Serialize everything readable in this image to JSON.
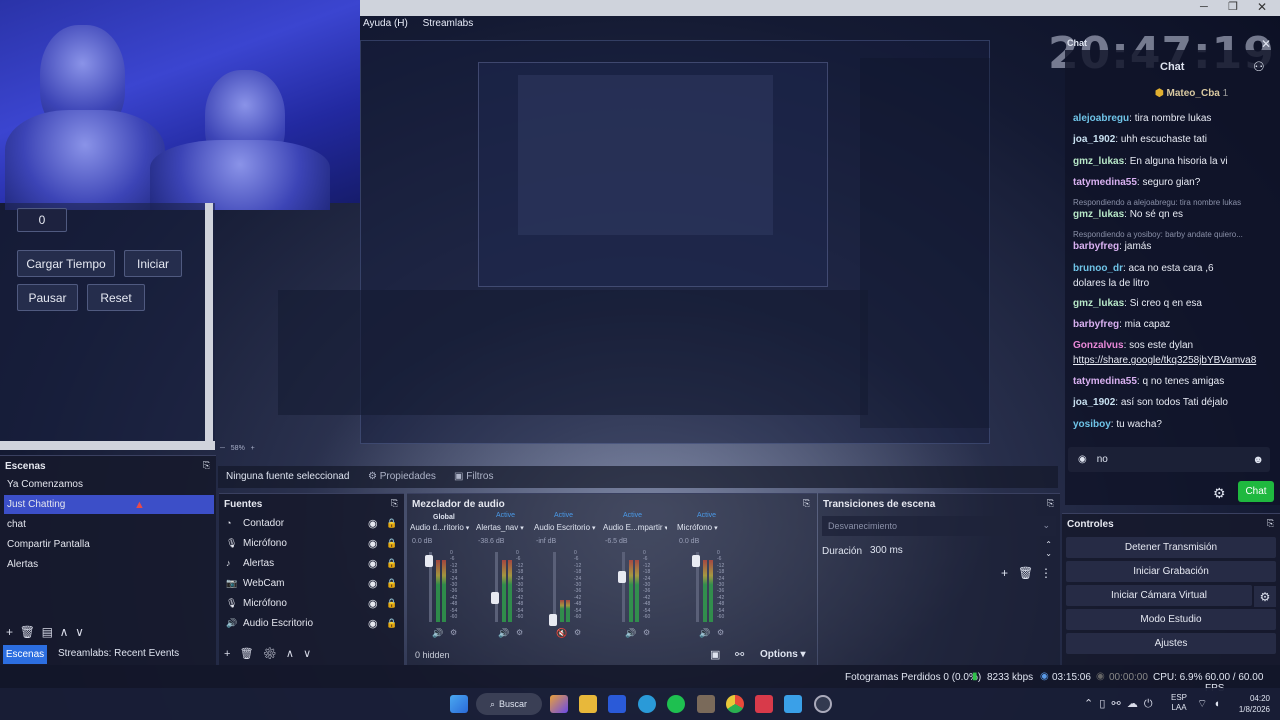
{
  "menu": [
    "Ayuda (H)",
    "Streamlabs"
  ],
  "clock": "20:47:19",
  "timer": {
    "value": "0",
    "load_label": "Cargar Tiempo",
    "start_label": "Iniciar",
    "pause_label": "Pausar",
    "reset_label": "Reset"
  },
  "chat": {
    "title": "Chat",
    "top_user": "Mateo_Cba",
    "top_count": "1",
    "input_value": "no",
    "send_label": "Chat",
    "messages": [
      {
        "user": "alejoabregu",
        "text": ": tira nombre lukas"
      },
      {
        "user": "joa_1902",
        "text": ": uhh escuchaste tati"
      },
      {
        "user": "gmz_lukas",
        "text": ": En alguna hisoria la vi"
      },
      {
        "user": "tatymedina55",
        "text": ": seguro gian?"
      },
      {
        "user": "",
        "text": "Respondiendo a alejoabregu: tira nombre lukas"
      },
      {
        "user": "gmz_lukas",
        "text": ": No sé qn es"
      },
      {
        "user": "",
        "text": "Respondiendo a yosiboy: barby andate quiero..."
      },
      {
        "user": "barbyfreg",
        "text": ": jamás"
      },
      {
        "user": "brunoo_dr",
        "text": ": aca no esta cara ,6"
      },
      {
        "user": "",
        "text": "dolares la de litro"
      },
      {
        "user": "gmz_lukas",
        "text": ": Si creo q en esa"
      },
      {
        "user": "barbyfreg",
        "text": ": mia capaz"
      },
      {
        "user": "Gonzalvus",
        "text": ": sos este dylan"
      },
      {
        "user": "",
        "text": "https://share.google/tkq3258jbYBVamva8"
      },
      {
        "user": "tatymedina55",
        "text": ": q no tenes amigas"
      },
      {
        "user": "joa_1902",
        "text": ": así son todos Tati déjalo"
      },
      {
        "user": "yosiboy",
        "text": ": tu wacha?"
      }
    ]
  },
  "scenes": {
    "title": "Escenas",
    "items": [
      "Ya Comenzamos",
      "Just Chatting",
      "chat",
      "Compartir Pantalla",
      "Alertas"
    ],
    "selected": 1
  },
  "tabs": {
    "scenes": "Escenas",
    "events": "Streamlabs: Recent Events"
  },
  "source_bar": {
    "none_selected": "Ninguna fuente seleccionad",
    "properties": "Propiedades",
    "filters": "Filtros"
  },
  "sources": {
    "title": "Fuentes",
    "items": [
      "Contador",
      "Micrófono",
      "Alertas",
      "WebCam",
      "Micrófono",
      "Audio Escritorio"
    ]
  },
  "mixer": {
    "title": "Mezclador de audio",
    "global": "Global",
    "hidden": "0 hidden",
    "options": "Options",
    "channels": [
      {
        "name": "Audio d...ritorio",
        "state": "",
        "db": "0.0 dB"
      },
      {
        "name": "Alertas_nav",
        "state": "Active",
        "db": "-38.6 dB"
      },
      {
        "name": "Audio Escritorio",
        "state": "Active",
        "db": "-inf dB"
      },
      {
        "name": "Audio E...mpartir",
        "state": "Active",
        "db": "-6.5 dB"
      },
      {
        "name": "Micrófono",
        "state": "Active",
        "db": "0.0 dB"
      }
    ]
  },
  "transitions": {
    "title": "Transiciones de escena",
    "type": "Desvanecimiento",
    "duration_label": "Duración",
    "duration_value": "300 ms"
  },
  "controls": {
    "title": "Controles",
    "buttons": [
      "Detener Transmisión",
      "Iniciar Grabación",
      "Iniciar Cámara Virtual",
      "Modo Estudio",
      "Ajustes"
    ]
  },
  "status": {
    "dropped": "Fotogramas Perdidos 0 (0.0%)",
    "kbps": "8233 kbps",
    "live_time": "03:15:06",
    "rec_time": "00:00:00",
    "cpu": "CPU: 6.9%",
    "fps": "60.00 / 60.00 FPS"
  },
  "taskbar": {
    "search": "Buscar",
    "lang": "ESP",
    "lang2": "LAA",
    "time": "04:20",
    "date": "1/8/2026"
  },
  "colors": {
    "selected_scene": "#3c4fc8",
    "chat_send": "#1fb83f",
    "accent": "#2c6ee0"
  }
}
